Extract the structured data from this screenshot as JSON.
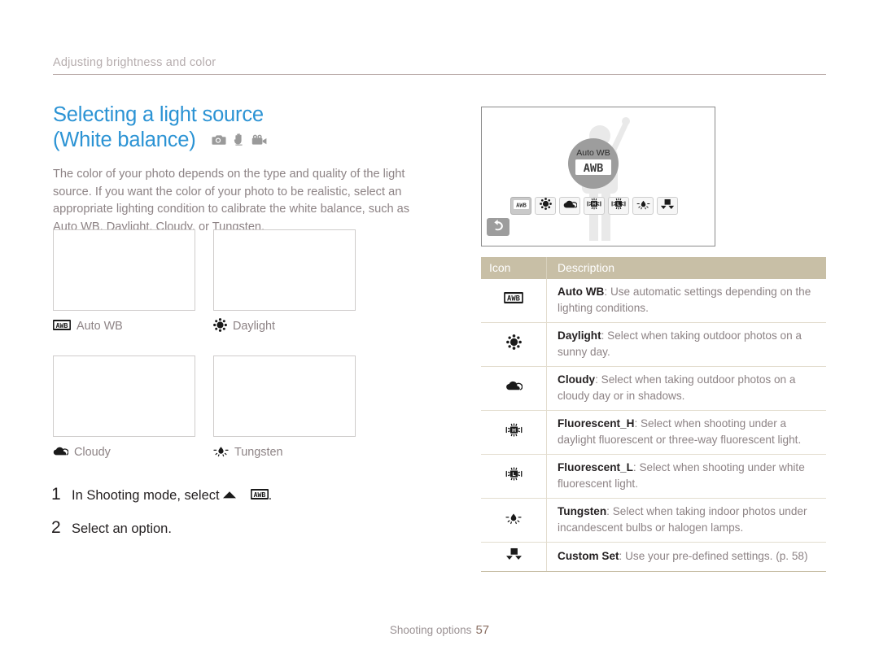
{
  "running_head": "Adjusting brightness and color",
  "section": {
    "title_line1": "Selecting a light source",
    "title_line2": "(White balance)",
    "mode_icons": [
      "program-mode-icon",
      "smart-auto-icon",
      "movie-mode-icon"
    ],
    "intro": "The color of your photo depends on the type and quality of the light source. If you want the color of your photo to be realistic, select an appropriate lighting condition to calibrate the white balance, such as Auto WB, Daylight, Cloudy, or Tungsten."
  },
  "samples": [
    {
      "icon": "awb-icon",
      "label": "Auto WB"
    },
    {
      "icon": "daylight-icon",
      "label": "Daylight"
    },
    {
      "icon": "cloudy-icon",
      "label": "Cloudy"
    },
    {
      "icon": "tungsten-icon",
      "label": "Tungsten"
    }
  ],
  "steps": [
    {
      "num": "1",
      "before": "In Shooting mode, select",
      "icon1": "up-arrow-icon",
      "icon2": "awb-icon",
      "after": "."
    },
    {
      "num": "2",
      "before": "Select an option.",
      "icon1": "",
      "icon2": "",
      "after": ""
    }
  ],
  "camera_screen": {
    "badge_label": "Auto WB",
    "badge_icon": "awb-icon",
    "back_icon": "back-arrow-icon",
    "options": [
      {
        "icon": "awb-icon",
        "selected": true
      },
      {
        "icon": "daylight-icon",
        "selected": false
      },
      {
        "icon": "cloudy-icon",
        "selected": false
      },
      {
        "icon": "fluorescent-h-icon",
        "selected": false
      },
      {
        "icon": "fluorescent-l-icon",
        "selected": false
      },
      {
        "icon": "tungsten-icon",
        "selected": false
      },
      {
        "icon": "custom-set-icon",
        "selected": false
      }
    ]
  },
  "table": {
    "headers": {
      "icon": "Icon",
      "description": "Description"
    },
    "rows": [
      {
        "icon": "awb-icon",
        "name": "Auto WB",
        "desc": ": Use automatic settings depending on the lighting conditions."
      },
      {
        "icon": "daylight-icon",
        "name": "Daylight",
        "desc": ": Select when taking outdoor photos on a sunny day."
      },
      {
        "icon": "cloudy-icon",
        "name": "Cloudy",
        "desc": ": Select when taking outdoor photos on a cloudy day or in shadows."
      },
      {
        "icon": "fluorescent-h-icon",
        "name": "Fluorescent_H",
        "desc": ": Select when shooting under a daylight fluorescent or three-way fluorescent light."
      },
      {
        "icon": "fluorescent-l-icon",
        "name": "Fluorescent_L",
        "desc": ": Select when shooting under white fluorescent light."
      },
      {
        "icon": "tungsten-icon",
        "name": "Tungsten",
        "desc": ": Select when taking indoor photos under incandescent bulbs or halogen lamps."
      },
      {
        "icon": "custom-set-icon",
        "name": "Custom Set",
        "desc": ": Use your pre-defined settings. (p. 58)"
      }
    ]
  },
  "footer": {
    "label": "Shooting options",
    "page": "57"
  },
  "colors": {
    "heading_blue": "#2b93d4",
    "body_gray": "#8d8385",
    "table_header_tan": "#c8bfa6",
    "rule_mauve": "#b8a9a7"
  }
}
